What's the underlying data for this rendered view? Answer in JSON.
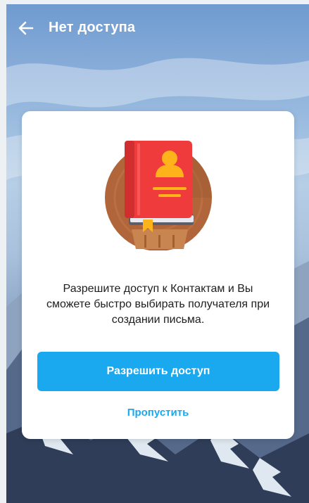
{
  "appbar": {
    "title": "Нет доступа",
    "back_icon": "arrow-left-icon"
  },
  "dialog": {
    "illustration_icon": "contacts-book-icon",
    "message": "Разрешите доступ к Контактам и Вы сможете быстро выбирать получателя при создании письма.",
    "allow_button_label": "Разрешить доступ",
    "skip_label": "Пропустить"
  },
  "colors": {
    "accent": "#1aa8ef",
    "book_red": "#ef3b3b",
    "book_orange": "#ffb31a",
    "circle_brown": "#b0663a"
  }
}
